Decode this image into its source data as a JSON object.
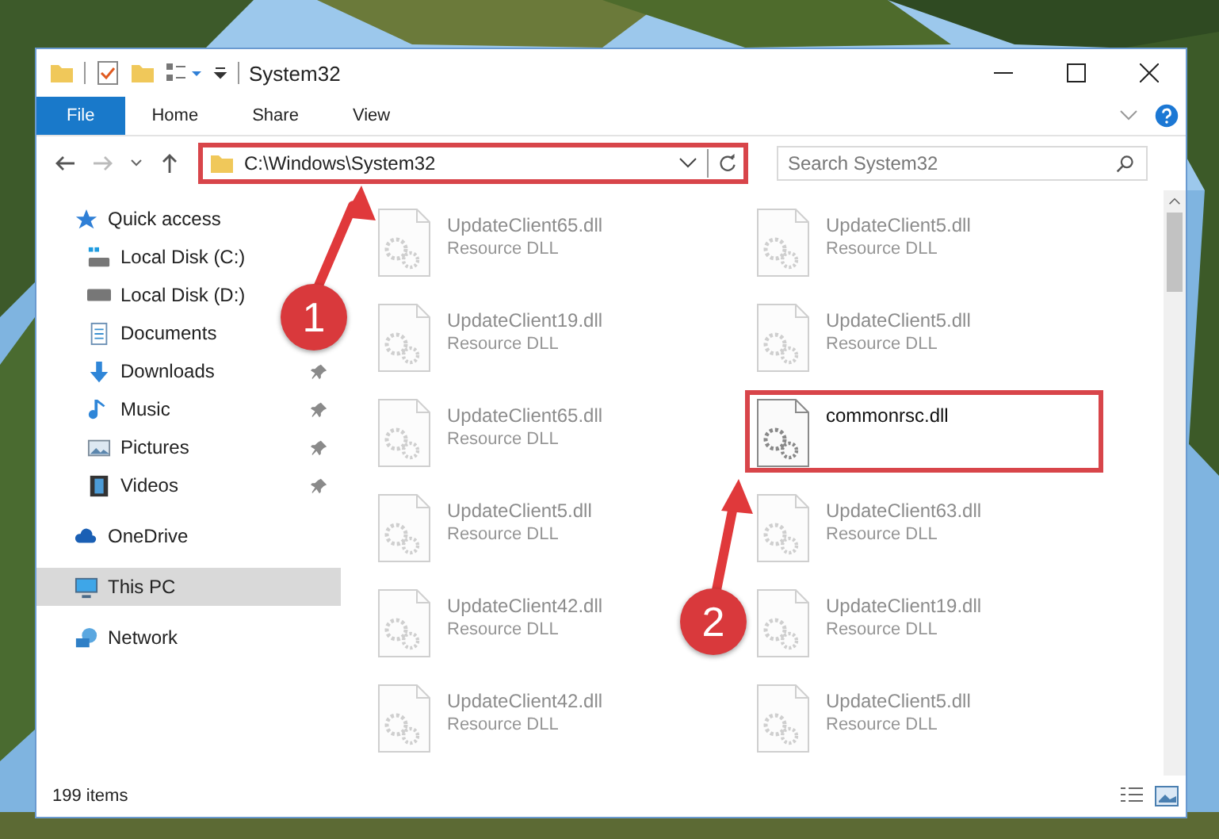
{
  "window": {
    "title": "System32"
  },
  "ribbon_tabs": [
    {
      "label": "File",
      "selected": true
    },
    {
      "label": "Home",
      "selected": false
    },
    {
      "label": "Share",
      "selected": false
    },
    {
      "label": "View",
      "selected": false
    }
  ],
  "address_bar": {
    "path": "C:\\Windows\\System32",
    "highlighted": true
  },
  "search": {
    "placeholder": "Search System32"
  },
  "sidebar": {
    "items": [
      {
        "label": "Quick access",
        "kind": "star",
        "selected": false,
        "children": [
          {
            "label": "Local Disk (C:)",
            "kind": "drive-win",
            "pinned": false,
            "selected": false
          },
          {
            "label": "Local Disk (D:)",
            "kind": "drive",
            "pinned": false,
            "selected": false
          },
          {
            "label": "Documents",
            "kind": "document",
            "pinned": false,
            "selected": false
          },
          {
            "label": "Downloads",
            "kind": "download",
            "pinned": true,
            "selected": false
          },
          {
            "label": "Music",
            "kind": "music",
            "pinned": true,
            "selected": false
          },
          {
            "label": "Pictures",
            "kind": "pictures",
            "pinned": true,
            "selected": false
          },
          {
            "label": "Videos",
            "kind": "videos",
            "pinned": true,
            "selected": false
          }
        ]
      },
      {
        "label": "OneDrive",
        "kind": "cloud",
        "selected": false
      },
      {
        "label": "This PC",
        "kind": "pc",
        "selected": true
      },
      {
        "label": "Network",
        "kind": "network",
        "selected": false
      }
    ]
  },
  "files": [
    {
      "name": "UpdateClient65.dll",
      "type": "Resource DLL",
      "dimmed": true,
      "highlighted": false
    },
    {
      "name": "UpdateClient5.dll",
      "type": "Resource DLL",
      "dimmed": true,
      "highlighted": false
    },
    {
      "name": "UpdateClient19.dll",
      "type": "Resource DLL",
      "dimmed": true,
      "highlighted": false
    },
    {
      "name": "UpdateClient5.dll",
      "type": "Resource DLL",
      "dimmed": true,
      "highlighted": false
    },
    {
      "name": "UpdateClient65.dll",
      "type": "Resource DLL",
      "dimmed": true,
      "highlighted": false
    },
    {
      "name": "commonrsc.dll",
      "dimmed": false,
      "highlighted": true
    },
    {
      "name": "UpdateClient5.dll",
      "type": "Resource DLL",
      "dimmed": true,
      "highlighted": false
    },
    {
      "name": "UpdateClient63.dll",
      "type": "Resource DLL",
      "dimmed": true,
      "highlighted": false
    },
    {
      "name": "UpdateClient42.dll",
      "type": "Resource DLL",
      "dimmed": true,
      "highlighted": false
    },
    {
      "name": "UpdateClient19.dll",
      "type": "Resource DLL",
      "dimmed": true,
      "highlighted": false
    },
    {
      "name": "UpdateClient42.dll",
      "type": "Resource DLL",
      "dimmed": true,
      "highlighted": false
    },
    {
      "name": "UpdateClient5.dll",
      "type": "Resource DLL",
      "dimmed": true,
      "highlighted": false
    }
  ],
  "status_bar": {
    "item_count": "199 items"
  },
  "callouts": [
    {
      "label": "1"
    },
    {
      "label": "2"
    }
  ]
}
